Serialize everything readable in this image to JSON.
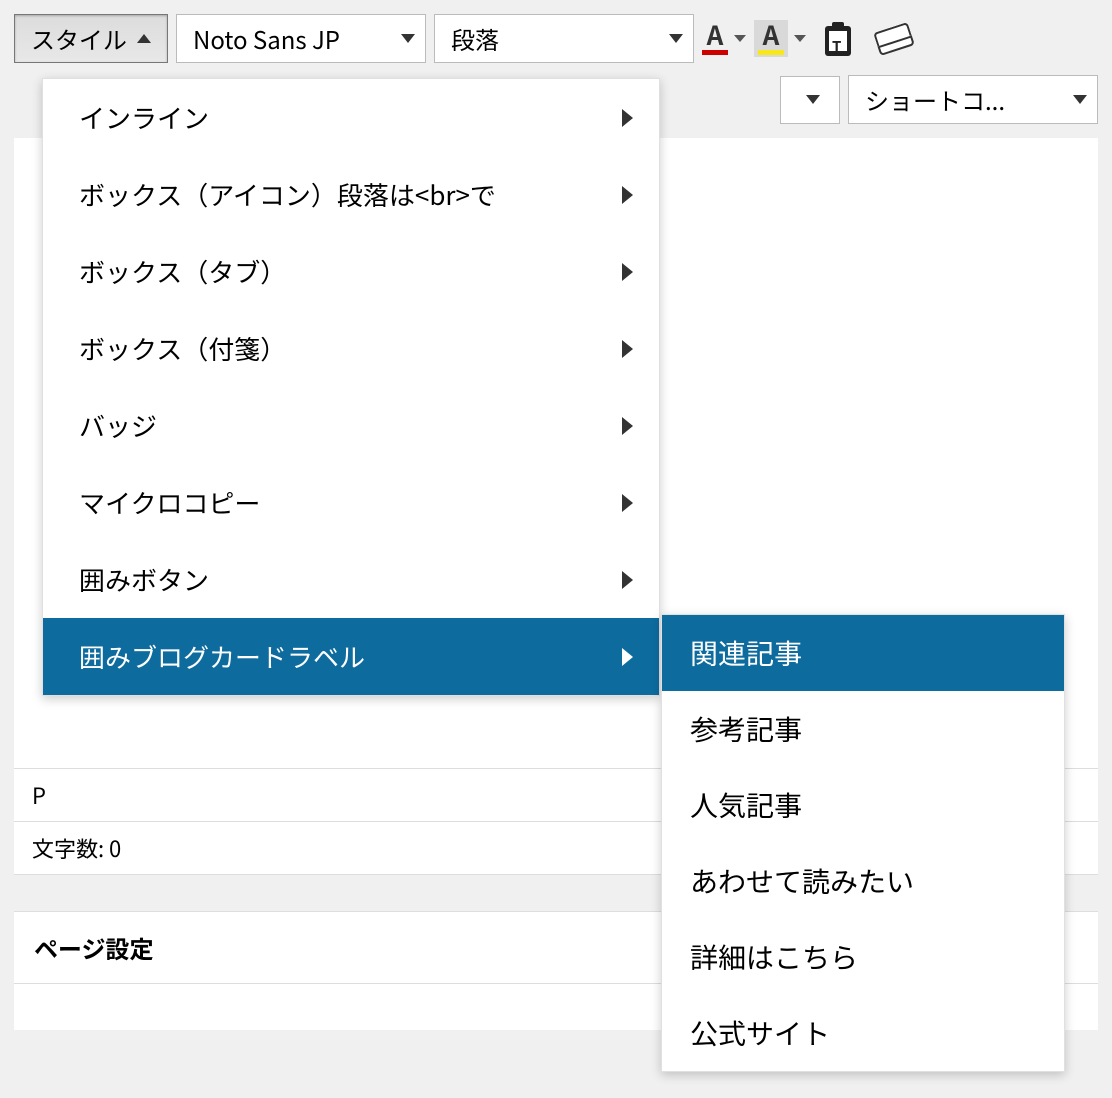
{
  "toolbar": {
    "style_button": "スタイル",
    "font_select": "Noto Sans JP",
    "paragraph_select": "段落",
    "shortcode_select": "ショートコ...",
    "text_color": "#cc0000",
    "bg_color": "#f8e71c"
  },
  "style_menu": [
    "インライン",
    "ボックス（アイコン）段落は<br>で",
    "ボックス（タブ）",
    "ボックス（付箋）",
    "バッジ",
    "マイクロコピー",
    "囲みボタン",
    "囲みブログカードラベル"
  ],
  "style_menu_active_index": 7,
  "submenu": [
    "関連記事",
    "参考記事",
    "人気記事",
    "あわせて読みたい",
    "詳細はこちら",
    "公式サイト"
  ],
  "submenu_active_index": 0,
  "status": {
    "path": "P",
    "char_count_label": "文字数: 0"
  },
  "section_title": "ページ設定"
}
